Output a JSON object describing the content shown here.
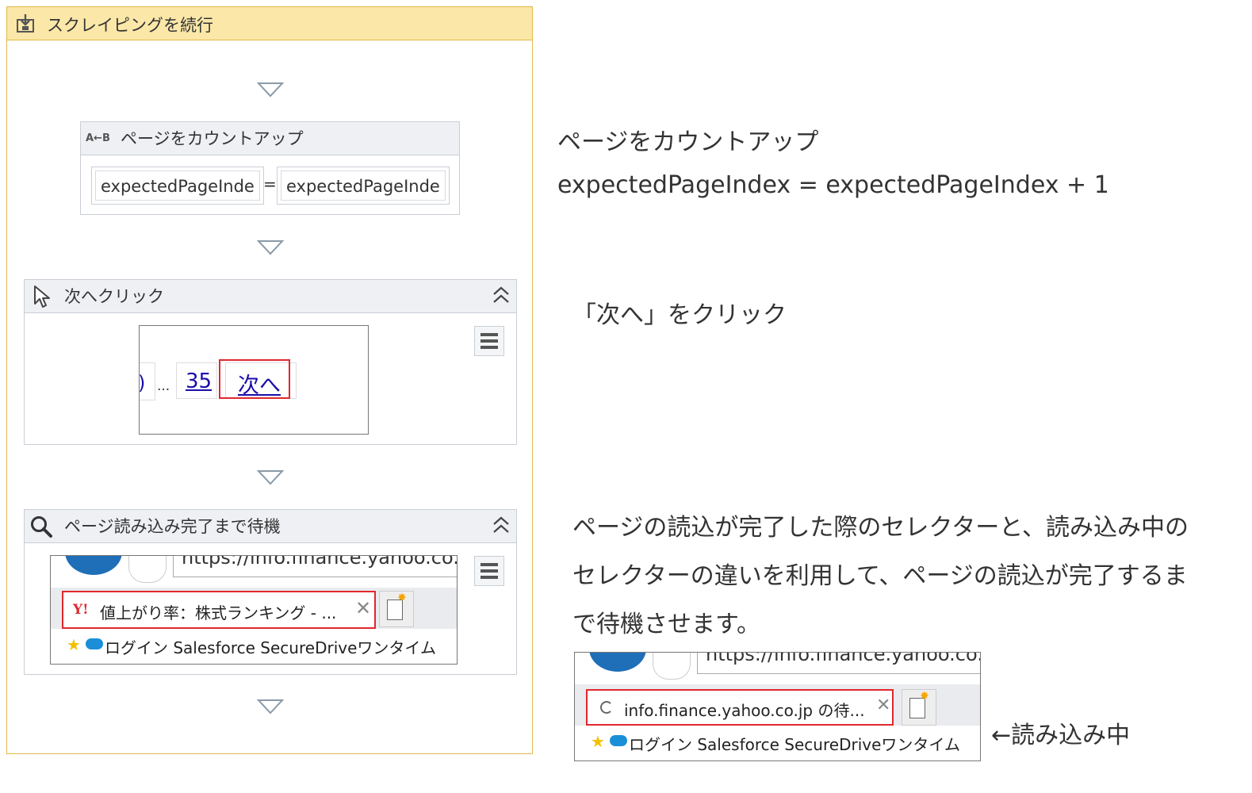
{
  "sequence": {
    "title": "スクレイピングを続行"
  },
  "assign": {
    "title": "ページをカウントアップ",
    "icon_label": "A←B",
    "left_value": "expectedPageInde",
    "operator": "=",
    "right_value": "expectedPageInde"
  },
  "click": {
    "title": "次へクリック",
    "page_ellipsis": "...",
    "page_number": "35",
    "next_link": "次へ"
  },
  "wait": {
    "title": "ページ読み込み完了まで待機",
    "url_text": "https://info.finance.yahoo.co.jp",
    "tab_title": "値上がり率：株式ランキング - ...",
    "yahoo_logo": "Y!",
    "bookmarks_text": "ログイン  Salesforce   SecureDriveワンタイム"
  },
  "notes": {
    "assign_title": "ページをカウントアップ",
    "assign_expr": "expectedPageIndex = expectedPageIndex + 1",
    "click_note": "「次へ」をクリック",
    "wait_line1": "ページの読込が完了した際のセレクターと、読み込み中の",
    "wait_line2": "セレクターの違いを利用して、ページの読込が完了するま",
    "wait_line3": "で待機させます。",
    "loading_label": "←読み込み中"
  },
  "loading_shot": {
    "url_text": "https://info.finance.yahoo.co.jp",
    "tab_title": "info.finance.yahoo.co.jp の待...",
    "bookmarks_text": "ログイン  Salesforce   SecureDriveワンタイム"
  },
  "colors": {
    "sequence_header": "#fbe7a8",
    "sequence_border": "#e2b94a",
    "highlight_red": "#e0282e",
    "link_blue": "#1a0dab"
  }
}
